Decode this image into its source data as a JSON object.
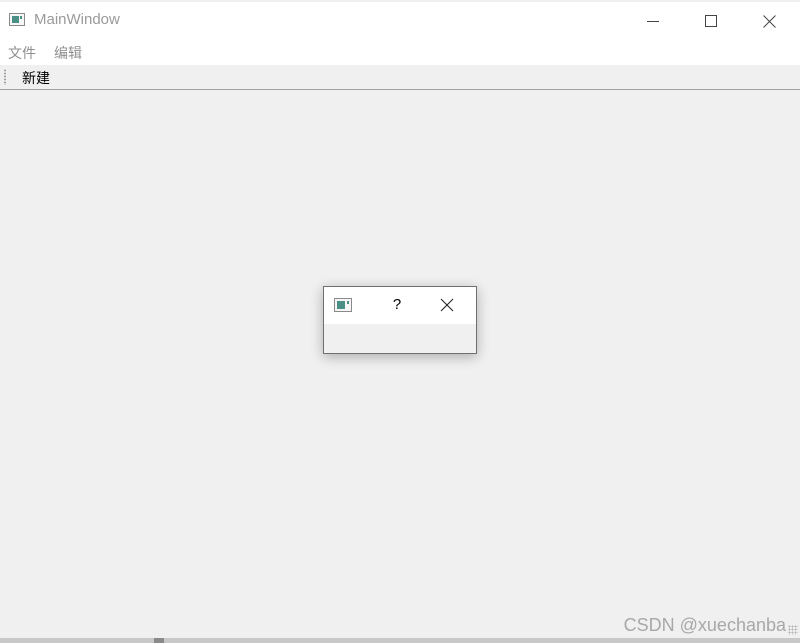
{
  "window": {
    "title": "MainWindow",
    "icon": "window-app-icon"
  },
  "caption_buttons": {
    "minimize_icon": "minimize-icon",
    "maximize_icon": "maximize-icon",
    "close_icon": "close-icon"
  },
  "menu": {
    "items": [
      {
        "label": "文件"
      },
      {
        "label": "编辑"
      }
    ]
  },
  "toolbar": {
    "new_label": "新建"
  },
  "dialog": {
    "title": "",
    "help_label": "?",
    "icon": "window-app-icon",
    "close_icon": "close-icon"
  },
  "watermark": {
    "text": "CSDN @xuechanba"
  },
  "colors": {
    "title_text": "#9a9a9a",
    "menu_text": "#8f8f8f",
    "client_background": "#f0f0f0",
    "icon_accent": "#4a8f85"
  }
}
